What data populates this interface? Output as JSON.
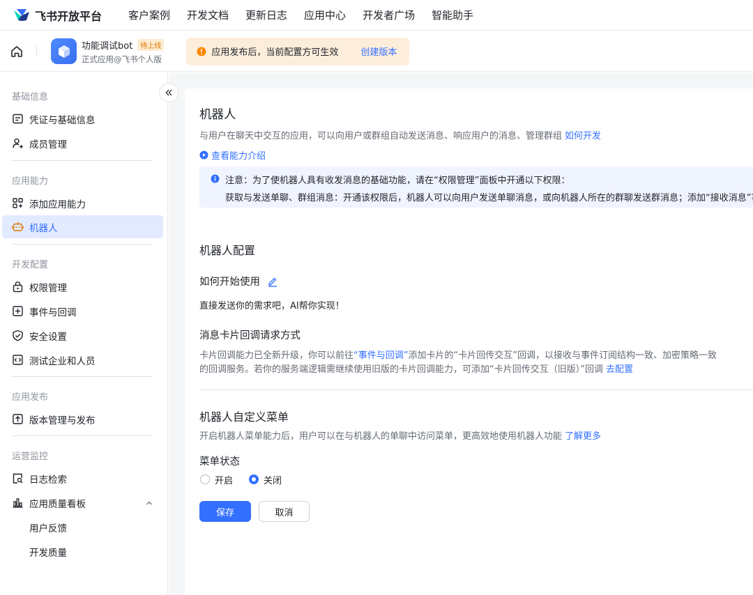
{
  "topnav": {
    "brand": "飞书开放平台",
    "links": [
      "客户案例",
      "开发文档",
      "更新日志",
      "应用中心",
      "开发者广场",
      "智能助手"
    ]
  },
  "appbar": {
    "app_name": "功能调试bot",
    "badge": "待上线",
    "app_sub": "正式应用@飞书个人版",
    "notice_text": "应用发布后，当前配置方可生效",
    "notice_link": "创建版本"
  },
  "sidebar": {
    "groups": [
      {
        "title": "基础信息",
        "items": [
          "凭证与基础信息",
          "成员管理"
        ]
      },
      {
        "title": "应用能力",
        "items": [
          "添加应用能力",
          "机器人"
        ]
      },
      {
        "title": "开发配置",
        "items": [
          "权限管理",
          "事件与回调",
          "安全设置",
          "测试企业和人员"
        ]
      },
      {
        "title": "应用发布",
        "items": [
          "版本管理与发布"
        ]
      },
      {
        "title": "运营监控",
        "items": [
          "日志检索",
          "应用质量看板",
          "用户反馈",
          "开发质量"
        ]
      }
    ]
  },
  "main": {
    "title": "机器人",
    "desc": "与用户在聊天中交互的应用，可以向用户或群组自动发送消息、响应用户的消息、管理群组",
    "desc_link": "如何开发",
    "intro_link": "查看能力介绍",
    "info_line1": "注意：为了使机器人具有收发消息的基础功能，请在“权限管理”面板中开通以下权限：",
    "info_line2": "获取与发送单聊、群组消息：开通该权限后，机器人可以向用户发送单聊消息，或向机器人所在的群聊发送群消息；添加“接收消息”事件",
    "config_title": "机器人配置",
    "howto_title": "如何开始使用",
    "howto_text": "直接发送你的需求吧，AI帮你实现！",
    "card_title": "消息卡片回调请求方式",
    "card_l1_a": "卡片回调能力已全新升级，你可以前往",
    "card_l1_link": "“事件与回调”",
    "card_l1_b": "添加卡片的“卡片回传交互”回调，以接收与事件订阅结构一致、加密策略一致",
    "card_l2": "的回调服务。若你的服务端逻辑需继续使用旧版的卡片回调能力，可添加“卡片回传交互（旧版）”回调",
    "card_l2_link": "去配置",
    "menu_title": "机器人自定义菜单",
    "menu_desc": "开启机器人菜单能力后，用户可以在与机器人的单聊中访问菜单，更高效地使用机器人功能",
    "menu_desc_link": "了解更多",
    "menu_status_label": "菜单状态",
    "radio_on": "开启",
    "radio_off": "关闭",
    "save": "保存",
    "cancel": "取消"
  }
}
